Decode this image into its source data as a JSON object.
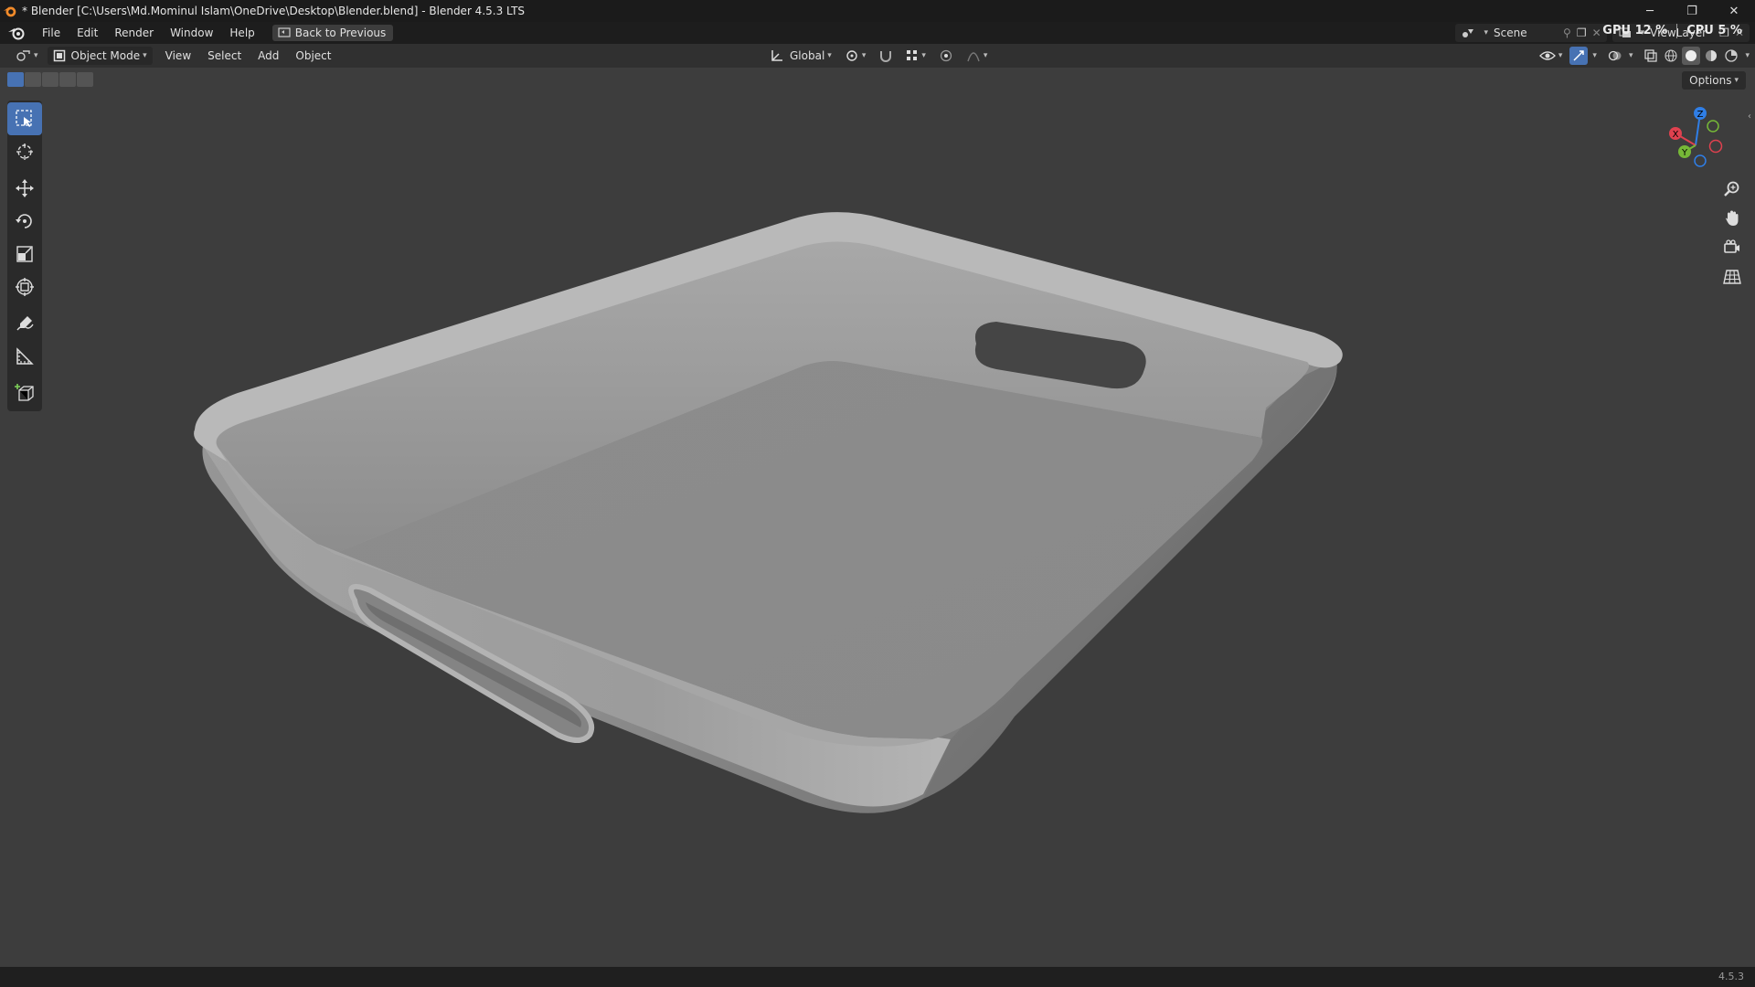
{
  "window": {
    "title": "* Blender [C:\\Users\\Md.Mominul Islam\\OneDrive\\Desktop\\Blender.blend] - Blender 4.5.3 LTS",
    "minimize": "─",
    "restore": "❐",
    "close": "✕"
  },
  "menu": {
    "items": [
      "File",
      "Edit",
      "Render",
      "Window",
      "Help"
    ],
    "back_button": "Back to Previous",
    "scene": "Scene",
    "view_layer": "ViewLayer"
  },
  "perf": {
    "gpu_label": "GPU",
    "gpu_value": "12 %",
    "cpu_label": "CPU",
    "cpu_value": "5 %"
  },
  "header3d": {
    "mode": "Object Mode",
    "items": [
      "View",
      "Select",
      "Add",
      "Object"
    ],
    "transform_orientation": "Global"
  },
  "viewport": {
    "options_label": "Options",
    "gizmo_axes": {
      "x": "X",
      "y": "Y",
      "z": "Z"
    },
    "colors": {
      "x": "#e0414f",
      "y": "#76b837",
      "z": "#2f7ee6"
    }
  },
  "status": {
    "version": "4.5.3"
  }
}
